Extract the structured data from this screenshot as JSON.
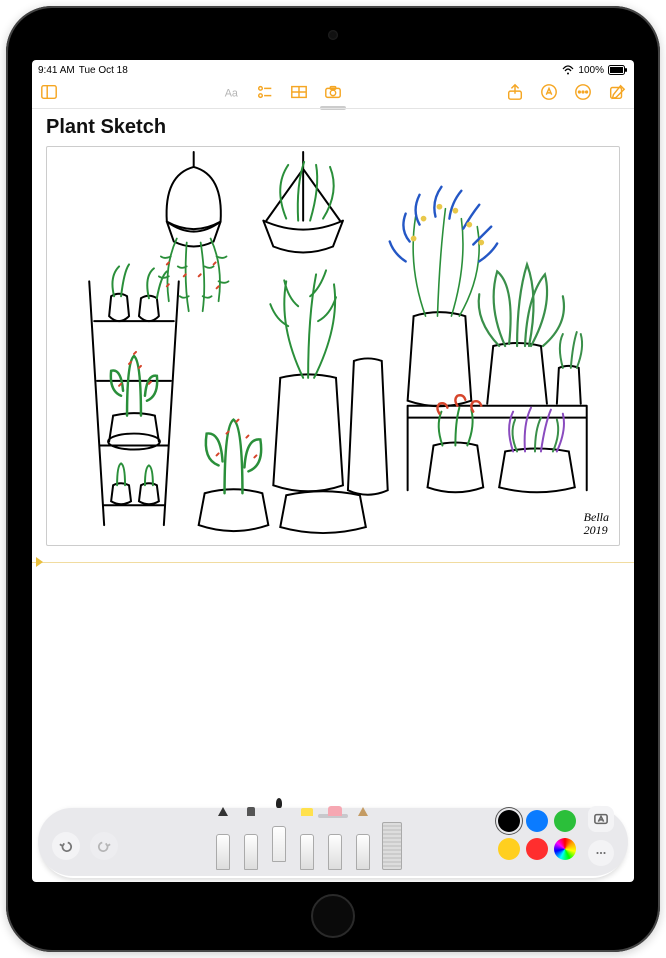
{
  "statusbar": {
    "time": "9:41 AM",
    "date": "Tue Oct 18",
    "battery_pct": "100%"
  },
  "note": {
    "title": "Plant Sketch",
    "signature_name": "Bella",
    "signature_year": "2019"
  },
  "palette": {
    "colors": {
      "black": "#000000",
      "blue": "#0a7bff",
      "green": "#2bbf3a",
      "yellow": "#ffcf1f",
      "red": "#ff2e2e",
      "pink": "#ff5bcb"
    },
    "selected": "black"
  }
}
